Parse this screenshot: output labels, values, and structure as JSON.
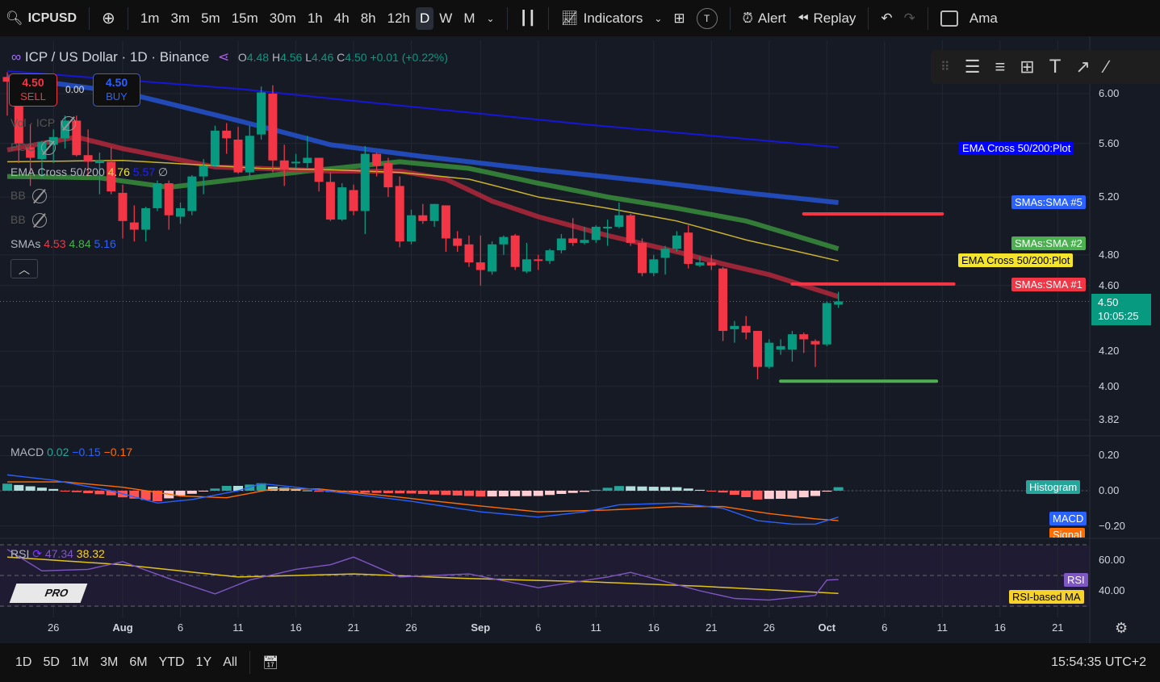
{
  "topbar": {
    "symbol": "ICPUSD",
    "timeframes": [
      "1m",
      "3m",
      "5m",
      "15m",
      "30m",
      "1h",
      "4h",
      "8h",
      "12h",
      "D",
      "W",
      "M"
    ],
    "active_timeframe": "D",
    "indicators": "Indicators",
    "template_badge": "T",
    "alert": "Alert",
    "replay": "Replay",
    "account": "Ama"
  },
  "legend": {
    "title": "ICP / US Dollar · 1D · Binance",
    "o_label": "O",
    "o": "4.48",
    "h_label": "H",
    "h": "4.56",
    "l_label": "L",
    "l": "4.46",
    "c_label": "C",
    "c": "4.50",
    "change": "+0.01 (+0.22%)",
    "sell_price": "4.50",
    "sell_label": "SELL",
    "spread": "0.00",
    "buy_price": "4.50",
    "buy_label": "BUY",
    "indicators": [
      {
        "name": "Vol · ICP"
      },
      {
        "name": "POC"
      },
      {
        "name": "EMA Cross 50/200",
        "v1": "4.76",
        "v2": "5.57"
      },
      {
        "name": "BB"
      },
      {
        "name": "BB"
      },
      {
        "name": "SMAs",
        "v1": "4.53",
        "v2": "4.84",
        "v3": "5.16"
      }
    ],
    "macd": {
      "name": "MACD",
      "hist": "0.02",
      "macd": "−0.15",
      "signal": "−0.17"
    },
    "rsi": {
      "name": "RSI",
      "rsi": "47.34",
      "ma": "38.32"
    }
  },
  "price_axis": [
    "6.00",
    "5.60",
    "5.20",
    "4.80",
    "4.60",
    "4.20",
    "4.00",
    "3.82"
  ],
  "macd_axis": [
    "0.20",
    "0.00",
    "−0.20"
  ],
  "rsi_axis": [
    "60.00",
    "40.00"
  ],
  "tags": {
    "ema200": "EMA Cross 50/200:Plot",
    "sma5": "SMAs:SMA #5",
    "sma2": "SMAs:SMA #2",
    "ema50": "EMA Cross 50/200:Plot",
    "sma1": "SMAs:SMA #1",
    "price": "4.50",
    "countdown": "10:05:25",
    "hist": "Histogram",
    "macd": "MACD",
    "signal": "Signal",
    "rsi": "RSI",
    "rsima": "RSI-based MA"
  },
  "colors": {
    "up": "#089981",
    "down": "#f23645",
    "sma1": "#b2283a",
    "sma2": "#388e3c",
    "sma5": "#2350c8",
    "ema50": "#c9b22a",
    "ema200": "#1616d8",
    "macd": "#2962ff",
    "signal": "#ff6d00",
    "rsi": "#7e57c2",
    "rsima": "#e0c31a"
  },
  "bottombar": {
    "ranges": [
      "1D",
      "5D",
      "1M",
      "3M",
      "6M",
      "YTD",
      "1Y",
      "All"
    ],
    "clock": "15:54:35 UTC+2"
  },
  "watermark": "PRO",
  "chart_data": {
    "type": "candlestick",
    "symbol": "ICP / US Dollar",
    "interval": "1D",
    "start_date": "Jul 22",
    "price_scale": "log",
    "x_ticks": [
      [
        4,
        "26"
      ],
      [
        10,
        "Aug"
      ],
      [
        15,
        "6"
      ],
      [
        20,
        "11"
      ],
      [
        25,
        "16"
      ],
      [
        30,
        "21"
      ],
      [
        35,
        "26"
      ],
      [
        41,
        "Sep"
      ],
      [
        46,
        "6"
      ],
      [
        51,
        "11"
      ],
      [
        56,
        "16"
      ],
      [
        61,
        "21"
      ],
      [
        66,
        "26"
      ],
      [
        71,
        "Oct"
      ],
      [
        76,
        "6"
      ],
      [
        81,
        "11"
      ],
      [
        86,
        "16"
      ],
      [
        91,
        "21"
      ]
    ],
    "ohlc": [
      [
        6.14,
        6.18,
        5.82,
        6.1
      ],
      [
        6.1,
        6.12,
        5.45,
        5.6
      ],
      [
        5.57,
        5.75,
        5.28,
        5.49
      ],
      [
        5.48,
        5.62,
        5.34,
        5.61
      ],
      [
        5.59,
        5.71,
        5.45,
        5.65
      ],
      [
        5.64,
        5.82,
        5.56,
        5.78
      ],
      [
        5.78,
        5.82,
        5.5,
        5.51
      ],
      [
        5.51,
        5.71,
        5.35,
        5.46
      ],
      [
        5.45,
        5.53,
        5.22,
        5.47
      ],
      [
        5.46,
        5.57,
        5.22,
        5.24
      ],
      [
        5.23,
        5.29,
        4.91,
        5.03
      ],
      [
        5.02,
        5.14,
        4.89,
        4.97
      ],
      [
        4.97,
        5.13,
        4.89,
        5.12
      ],
      [
        5.12,
        5.32,
        5.1,
        5.3
      ],
      [
        5.3,
        5.32,
        4.97,
        5.07
      ],
      [
        5.06,
        5.16,
        5.01,
        5.12
      ],
      [
        5.1,
        5.36,
        5.07,
        5.35
      ],
      [
        5.35,
        5.48,
        5.22,
        5.43
      ],
      [
        5.43,
        5.74,
        5.42,
        5.7
      ],
      [
        5.7,
        5.76,
        5.52,
        5.64
      ],
      [
        5.63,
        5.73,
        5.37,
        5.38
      ],
      [
        5.38,
        5.74,
        5.33,
        5.66
      ],
      [
        5.67,
        6.06,
        5.63,
        6.01
      ],
      [
        6.0,
        6.07,
        5.38,
        5.47
      ],
      [
        5.47,
        5.59,
        5.28,
        5.4
      ],
      [
        5.45,
        5.52,
        5.41,
        5.46
      ],
      [
        5.45,
        5.66,
        5.41,
        5.49
      ],
      [
        5.49,
        5.49,
        5.24,
        5.31
      ],
      [
        5.31,
        5.38,
        5.03,
        5.04
      ],
      [
        5.04,
        5.3,
        5.03,
        5.27
      ],
      [
        5.25,
        5.29,
        5.07,
        5.1
      ],
      [
        5.1,
        5.58,
        4.94,
        5.52
      ],
      [
        5.52,
        5.53,
        5.35,
        5.43
      ],
      [
        5.45,
        5.49,
        5.2,
        5.27
      ],
      [
        5.28,
        5.35,
        4.85,
        4.89
      ],
      [
        4.89,
        5.11,
        4.87,
        5.07
      ],
      [
        5.07,
        5.15,
        5.01,
        5.03
      ],
      [
        5.03,
        5.15,
        4.99,
        5.15
      ],
      [
        5.14,
        5.14,
        4.82,
        4.91
      ],
      [
        4.91,
        4.96,
        4.82,
        4.86
      ],
      [
        4.87,
        4.93,
        4.72,
        4.75
      ],
      [
        4.75,
        4.93,
        4.6,
        4.7
      ],
      [
        4.69,
        4.89,
        4.67,
        4.87
      ],
      [
        4.87,
        4.93,
        4.8,
        4.92
      ],
      [
        4.93,
        4.94,
        4.7,
        4.72
      ],
      [
        4.69,
        4.88,
        4.68,
        4.77
      ],
      [
        4.77,
        4.8,
        4.7,
        4.76
      ],
      [
        4.76,
        4.84,
        4.74,
        4.83
      ],
      [
        4.83,
        4.94,
        4.81,
        4.91
      ],
      [
        4.91,
        5.05,
        4.86,
        4.88
      ],
      [
        4.88,
        4.99,
        4.87,
        4.9
      ],
      [
        4.9,
        5.0,
        4.88,
        4.99
      ],
      [
        4.98,
        5.04,
        4.86,
        4.99
      ],
      [
        4.99,
        5.16,
        4.98,
        5.07
      ],
      [
        5.07,
        5.08,
        4.86,
        4.88
      ],
      [
        4.88,
        4.91,
        4.66,
        4.68
      ],
      [
        4.68,
        4.8,
        4.66,
        4.77
      ],
      [
        4.78,
        4.86,
        4.67,
        4.84
      ],
      [
        4.84,
        4.96,
        4.82,
        4.93
      ],
      [
        4.95,
        5.0,
        4.71,
        4.74
      ],
      [
        4.73,
        4.79,
        4.72,
        4.75
      ],
      [
        4.75,
        4.8,
        4.7,
        4.73
      ],
      [
        4.71,
        4.72,
        4.26,
        4.32
      ],
      [
        4.33,
        4.38,
        4.25,
        4.35
      ],
      [
        4.35,
        4.41,
        4.27,
        4.31
      ],
      [
        4.32,
        4.32,
        4.04,
        4.11
      ],
      [
        4.11,
        4.27,
        4.1,
        4.25
      ],
      [
        4.21,
        4.27,
        4.18,
        4.23
      ],
      [
        4.21,
        4.32,
        4.14,
        4.3
      ],
      [
        4.3,
        4.31,
        4.19,
        4.27
      ],
      [
        4.26,
        4.27,
        4.11,
        4.24
      ],
      [
        4.24,
        4.5,
        4.23,
        4.49
      ],
      [
        4.48,
        4.56,
        4.46,
        4.5
      ]
    ],
    "overlays": {
      "sma1": [
        [
          0,
          5.55
        ],
        [
          6,
          5.65
        ],
        [
          10,
          5.56
        ],
        [
          18,
          5.42
        ],
        [
          22,
          5.41
        ],
        [
          28,
          5.39
        ],
        [
          34,
          5.39
        ],
        [
          38,
          5.33
        ],
        [
          42,
          5.17
        ],
        [
          46,
          5.06
        ],
        [
          52,
          4.93
        ],
        [
          58,
          4.82
        ],
        [
          62,
          4.74
        ],
        [
          66,
          4.67
        ],
        [
          72,
          4.53
        ]
      ],
      "ema50": [
        [
          0,
          5.46
        ],
        [
          10,
          5.47
        ],
        [
          22,
          5.41
        ],
        [
          28,
          5.4
        ],
        [
          34,
          5.38
        ],
        [
          40,
          5.33
        ],
        [
          46,
          5.2
        ],
        [
          52,
          5.12
        ],
        [
          58,
          5.03
        ],
        [
          64,
          4.9
        ],
        [
          72,
          4.76
        ]
      ],
      "sma2": [
        [
          0,
          5.35
        ],
        [
          8,
          5.34
        ],
        [
          14,
          5.27
        ],
        [
          20,
          5.33
        ],
        [
          26,
          5.39
        ],
        [
          34,
          5.46
        ],
        [
          40,
          5.41
        ],
        [
          46,
          5.3
        ],
        [
          52,
          5.2
        ],
        [
          58,
          5.12
        ],
        [
          64,
          5.03
        ],
        [
          72,
          4.84
        ]
      ],
      "sma5": [
        [
          0,
          6.14
        ],
        [
          10,
          6.01
        ],
        [
          20,
          5.78
        ],
        [
          28,
          5.59
        ],
        [
          36,
          5.5
        ],
        [
          46,
          5.4
        ],
        [
          56,
          5.31
        ],
        [
          64,
          5.23
        ],
        [
          72,
          5.16
        ]
      ],
      "ema200": [
        [
          0,
          6.19
        ],
        [
          20,
          6.04
        ],
        [
          30,
          5.94
        ],
        [
          50,
          5.75
        ],
        [
          72,
          5.57
        ]
      ]
    },
    "drawings": [
      {
        "color": "#f23645",
        "price": 5.08,
        "from": 69,
        "to": 81
      },
      {
        "color": "#f23645",
        "price": 4.61,
        "from": 68,
        "to": 82
      },
      {
        "color": "#4caf50",
        "price": 4.03,
        "from": 67,
        "to": 80.5
      }
    ],
    "last_price": 4.5,
    "macd": {
      "ylim": [
        -0.23,
        0.25
      ],
      "macd": [
        [
          0,
          0.09
        ],
        [
          4,
          0.06
        ],
        [
          9,
          0.0
        ],
        [
          13,
          -0.07
        ],
        [
          16,
          -0.05
        ],
        [
          20,
          0.0
        ],
        [
          22,
          0.04
        ],
        [
          25,
          0.02
        ],
        [
          30,
          -0.02
        ],
        [
          35,
          -0.06
        ],
        [
          41,
          -0.12
        ],
        [
          46,
          -0.15
        ],
        [
          50,
          -0.12
        ],
        [
          53,
          -0.08
        ],
        [
          58,
          -0.07
        ],
        [
          62,
          -0.1
        ],
        [
          65,
          -0.17
        ],
        [
          68,
          -0.19
        ],
        [
          70,
          -0.19
        ],
        [
          72,
          -0.15
        ]
      ],
      "signal": [
        [
          0,
          0.05
        ],
        [
          5,
          0.05
        ],
        [
          10,
          0.02
        ],
        [
          15,
          -0.03
        ],
        [
          19,
          -0.04
        ],
        [
          23,
          0.01
        ],
        [
          27,
          0.01
        ],
        [
          33,
          -0.03
        ],
        [
          40,
          -0.08
        ],
        [
          46,
          -0.12
        ],
        [
          52,
          -0.11
        ],
        [
          58,
          -0.09
        ],
        [
          62,
          -0.09
        ],
        [
          66,
          -0.13
        ],
        [
          70,
          -0.16
        ],
        [
          72,
          -0.17
        ]
      ]
    },
    "rsi": {
      "ylim": [
        25,
        75
      ],
      "bands": [
        30,
        70
      ],
      "rsi": [
        [
          0,
          67
        ],
        [
          3,
          53
        ],
        [
          7,
          54
        ],
        [
          10,
          59
        ],
        [
          14,
          48
        ],
        [
          18,
          38
        ],
        [
          21,
          47
        ],
        [
          25,
          54
        ],
        [
          28,
          57
        ],
        [
          30,
          62
        ],
        [
          34,
          49
        ],
        [
          40,
          51
        ],
        [
          46,
          42
        ],
        [
          52,
          49
        ],
        [
          54,
          52
        ],
        [
          60,
          40
        ],
        [
          63,
          35
        ],
        [
          66,
          34
        ],
        [
          70,
          37
        ],
        [
          71,
          47
        ],
        [
          72,
          47.34
        ]
      ],
      "ma": [
        [
          0,
          62
        ],
        [
          10,
          57
        ],
        [
          20,
          49
        ],
        [
          30,
          51
        ],
        [
          40,
          48
        ],
        [
          50,
          46
        ],
        [
          60,
          43
        ],
        [
          72,
          38.32
        ]
      ]
    }
  }
}
